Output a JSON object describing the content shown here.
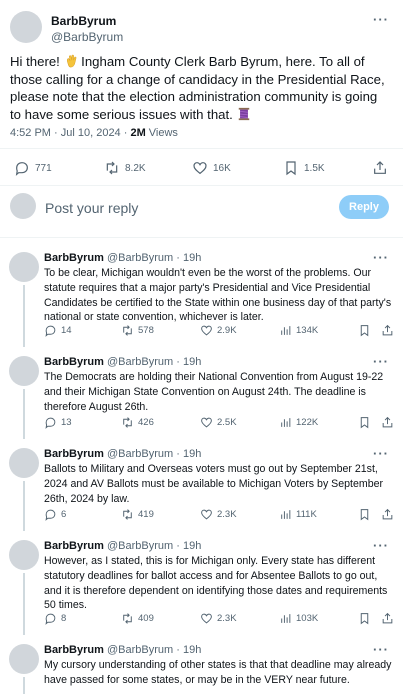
{
  "main_tweet": {
    "name": "BarbByrum",
    "handle": "@BarbByrum",
    "text_before_emoji": "Hi there! ",
    "emoji_1": "waving-hand-icon",
    "text_middle": " Ingham County Clerk Barb Byrum, here. To all of those calling for a change of candidacy in the Presidential Race, please note that the election administration community is going to have some serious issues with that. ",
    "emoji_2": "spool-of-thread-icon",
    "time": "4:52 PM · Jul 10, 2024 · ",
    "views_count": "2M",
    "views_label": " Views",
    "stats": {
      "replies": "771",
      "reposts": "8.2K",
      "likes": "16K",
      "bookmarks": "1.5K"
    }
  },
  "reply_box": {
    "placeholder": "Post your reply",
    "button_label": "Reply"
  },
  "thread": [
    {
      "name": "BarbByrum",
      "handle": "@BarbByrum",
      "time": "19h",
      "text": "To be clear, Michigan wouldn't even be the worst of the problems. Our statute requires that a major party's Presidential and Vice Presidential Candidates be certified to the State within one business day of that party's national or state convention, whichever is later.",
      "replies": "14",
      "reposts": "578",
      "likes": "2.9K",
      "views": "134K"
    },
    {
      "name": "BarbByrum",
      "handle": "@BarbByrum",
      "time": "19h",
      "text": "The Democrats are holding their National Convention from August 19-22 and their Michigan State Convention on August 24th. The deadline is therefore August 26th.",
      "replies": "13",
      "reposts": "426",
      "likes": "2.5K",
      "views": "122K"
    },
    {
      "name": "BarbByrum",
      "handle": "@BarbByrum",
      "time": "19h",
      "text": "Ballots to Military and Overseas voters must go out by September 21st, 2024 and AV Ballots must be available to Michigan Voters by September 26th, 2024 by law.",
      "replies": "6",
      "reposts": "419",
      "likes": "2.3K",
      "views": "111K"
    },
    {
      "name": "BarbByrum",
      "handle": "@BarbByrum",
      "time": "19h",
      "text": "However, as I stated, this is for Michigan only. Every state has different statutory deadlines for ballot access and for Absentee Ballots to go out, and it is therefore dependent on identifying those dates and requirements 50 times.",
      "replies": "8",
      "reposts": "409",
      "likes": "2.3K",
      "views": "103K"
    },
    {
      "name": "BarbByrum",
      "handle": "@BarbByrum",
      "time": "19h",
      "text": "My cursory understanding of other states is that that deadline may already have passed for some states, or may be in the VERY near future."
    }
  ],
  "ui": {
    "separator_dot": "·",
    "more_glyph": "···",
    "reply_button_color": "#8ecdf8",
    "icon_color": "#536471"
  }
}
